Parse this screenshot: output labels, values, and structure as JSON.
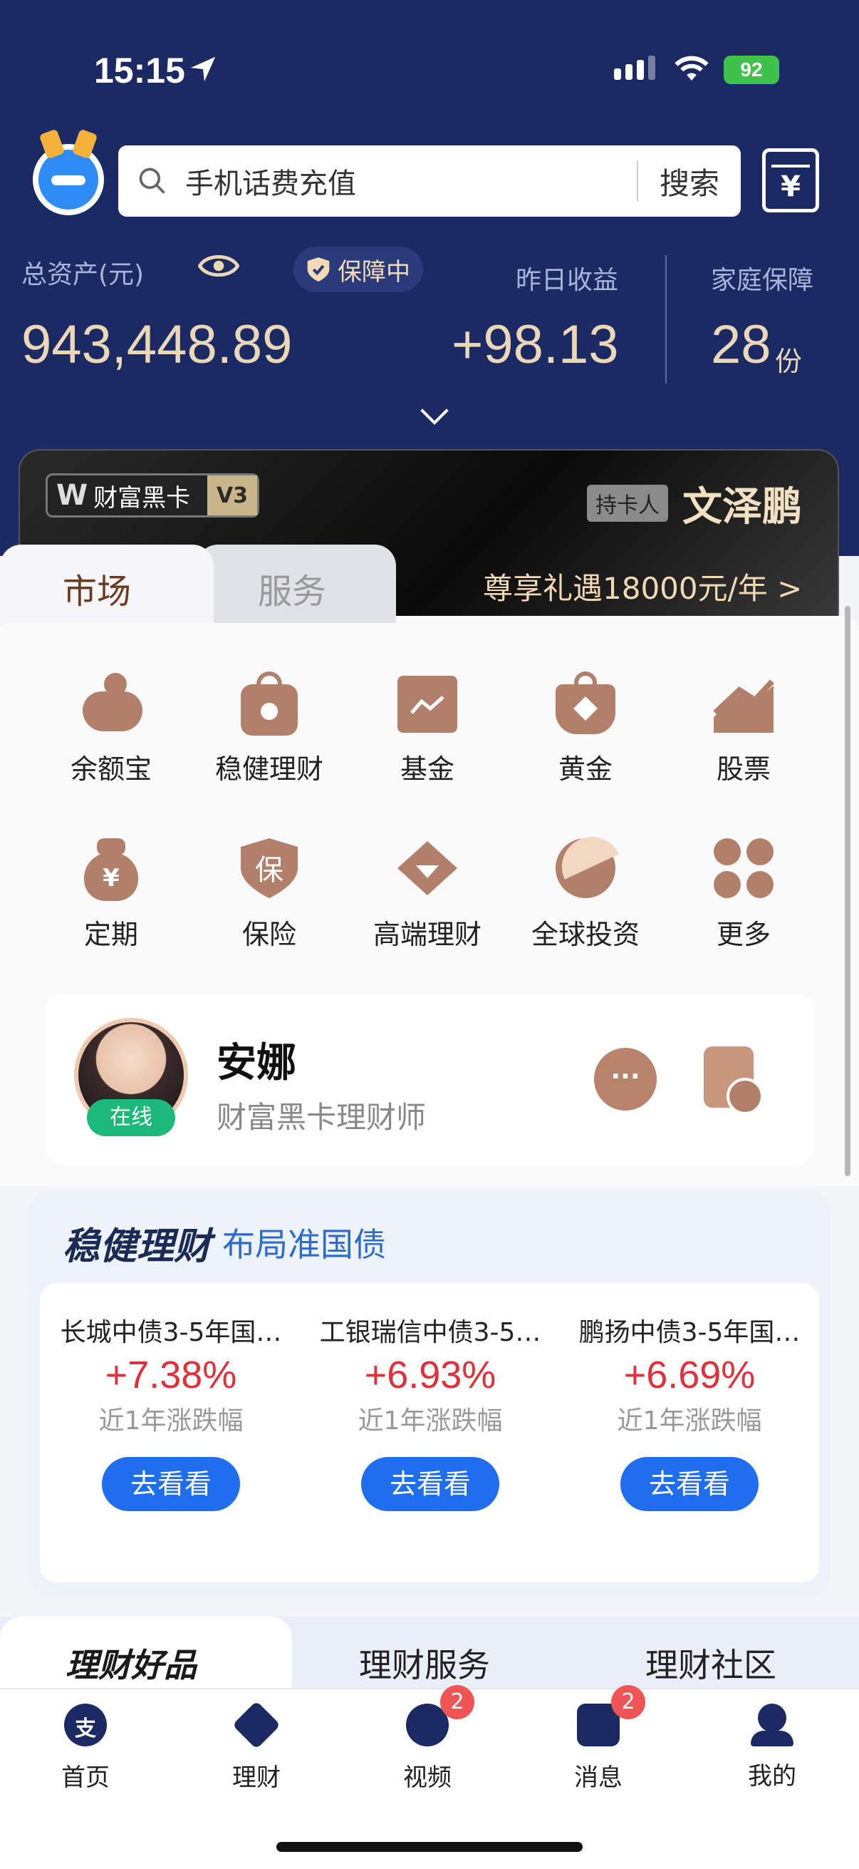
{
  "status": {
    "time": "15:15",
    "battery": "92"
  },
  "header": {
    "search_text": "手机话费充值",
    "search_button": "搜索",
    "total_assets_label": "总资产(元)",
    "protection_badge": "保障中",
    "total_assets": "943,448.89",
    "yesterday_label": "昨日收益",
    "yesterday_value": "+98.13",
    "family_label": "家庭保障",
    "family_value": "28",
    "family_unit": "份"
  },
  "card": {
    "brand": "财富黑卡",
    "level": "V3",
    "holder_tag": "持卡人",
    "holder_name": "文泽鹏",
    "privilege": "尊享礼遇18000元/年 >"
  },
  "tabs": {
    "market": "市场",
    "service": "服务"
  },
  "grid": [
    {
      "label": "余额宝",
      "icon": "yuebao-icon"
    },
    {
      "label": "稳健理财",
      "icon": "steady-finance-icon"
    },
    {
      "label": "基金",
      "icon": "fund-icon"
    },
    {
      "label": "黄金",
      "icon": "gold-icon"
    },
    {
      "label": "股票",
      "icon": "stock-icon"
    },
    {
      "label": "定期",
      "icon": "fixed-term-icon"
    },
    {
      "label": "保险",
      "icon": "insurance-icon"
    },
    {
      "label": "高端理财",
      "icon": "premium-finance-icon"
    },
    {
      "label": "全球投资",
      "icon": "global-invest-icon"
    },
    {
      "label": "更多",
      "icon": "more-icon"
    }
  ],
  "advisor": {
    "name": "安娜",
    "title": "财富黑卡理财师",
    "online": "在线"
  },
  "wealth": {
    "title": "稳健理财",
    "subtitle": "布局准国债",
    "products": [
      {
        "name": "长城中债3-5年国…",
        "rate": "+7.38%",
        "caption": "近1年涨跌幅",
        "button": "去看看"
      },
      {
        "name": "工银瑞信中债3-5…",
        "rate": "+6.93%",
        "caption": "近1年涨跌幅",
        "button": "去看看"
      },
      {
        "name": "鹏扬中债3-5年国…",
        "rate": "+6.69%",
        "caption": "近1年涨跌幅",
        "button": "去看看"
      }
    ]
  },
  "bottom_tabs": [
    "理财好品",
    "理财服务",
    "理财社区"
  ],
  "tabbar": [
    {
      "label": "首页",
      "badge": ""
    },
    {
      "label": "理财",
      "badge": ""
    },
    {
      "label": "视频",
      "badge": "2"
    },
    {
      "label": "消息",
      "badge": "2"
    },
    {
      "label": "我的",
      "badge": ""
    }
  ]
}
